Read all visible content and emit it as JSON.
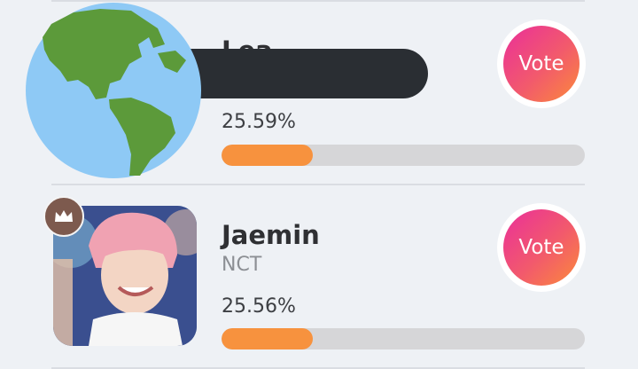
{
  "candidates": [
    {
      "name": "Lea",
      "percent_label": "25.59%",
      "percent_value": 25.59,
      "vote_label": "Vote",
      "progress_fraction": 0.25
    },
    {
      "name": "Jaemin",
      "group": "NCT",
      "percent_label": "25.56%",
      "percent_value": 25.56,
      "vote_label": "Vote",
      "progress_fraction": 0.25
    }
  ],
  "icons": {
    "first_overlay": "globe-emoji-icon",
    "rank_badge": "crown-icon"
  },
  "colors": {
    "progress_fill": "#f7923e",
    "progress_track": "#d6d6d8",
    "vote_gradient_start": "#ea2f9a",
    "vote_gradient_end": "#fb8a3a"
  }
}
